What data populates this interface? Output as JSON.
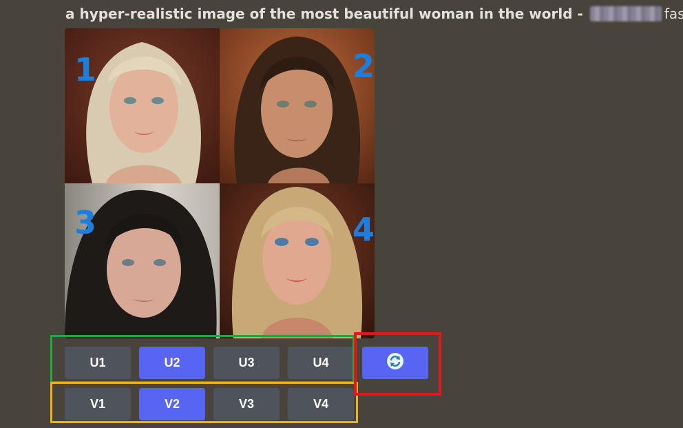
{
  "prompt": {
    "text": "a hyper-realistic image of the most beautiful woman in the world - ",
    "suffix": "fast)"
  },
  "images": [
    {
      "number": "1",
      "hair": "#d8cbb1",
      "bg": "#5a2a1e"
    },
    {
      "number": "2",
      "hair": "#3a2418",
      "bg": "#a0502c"
    },
    {
      "number": "3",
      "hair": "#1e1a18",
      "bg": "#c8c4bc"
    },
    {
      "number": "4",
      "hair": "#c9a878",
      "bg": "#4a2418"
    }
  ],
  "upscale_buttons": [
    {
      "label": "U1",
      "selected": false
    },
    {
      "label": "U2",
      "selected": true
    },
    {
      "label": "U3",
      "selected": false
    },
    {
      "label": "U4",
      "selected": false
    }
  ],
  "variation_buttons": [
    {
      "label": "V1",
      "selected": false
    },
    {
      "label": "V2",
      "selected": true
    },
    {
      "label": "V3",
      "selected": false
    },
    {
      "label": "V4",
      "selected": false
    }
  ],
  "reroll_button": {
    "icon": "refresh-icon"
  },
  "colors": {
    "button": "#4f545c",
    "button_active": "#5865f2",
    "background": "#48433b",
    "highlight_green": "#1faa40",
    "highlight_yellow": "#f0b113",
    "highlight_red": "#e8141a",
    "number_blue": "#1c7fe0"
  }
}
